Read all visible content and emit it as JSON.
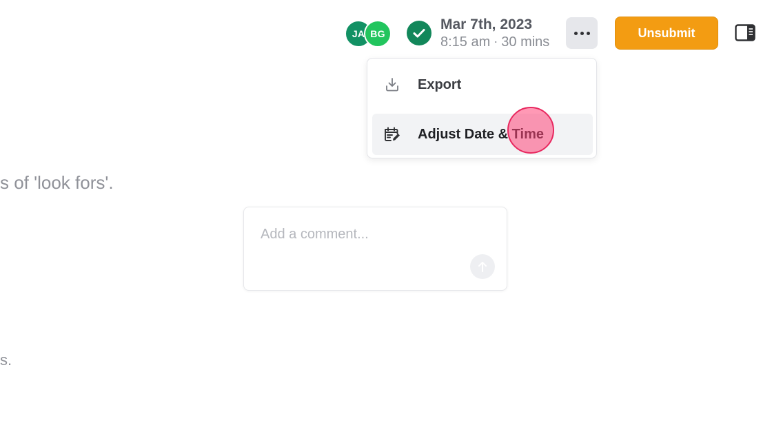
{
  "header": {
    "avatars": [
      {
        "initials": "JA",
        "color": "#129164"
      },
      {
        "initials": "BG",
        "color": "#22c55e"
      }
    ],
    "status_icon": "check-circle-icon",
    "date": "Mar 7th, 2023",
    "time": "8:15 am",
    "separator": "·",
    "duration": "30 mins",
    "more_icon": "more-horizontal-icon",
    "unsubmit_label": "Unsubmit",
    "unsubmit_color": "#f39c12",
    "panel_toggle_icon": "sidebar-panel-icon"
  },
  "menu": {
    "items": [
      {
        "label": "Export",
        "icon": "download-icon"
      },
      {
        "label": "Adjust Date & Time",
        "icon": "calendar-edit-icon",
        "highlighted": true
      }
    ]
  },
  "content": {
    "partial_text_1": "s of 'look fors'.",
    "partial_text_2": "s.",
    "comment": {
      "placeholder": "Add a comment...",
      "value": "",
      "send_icon": "arrow-up-icon"
    }
  }
}
